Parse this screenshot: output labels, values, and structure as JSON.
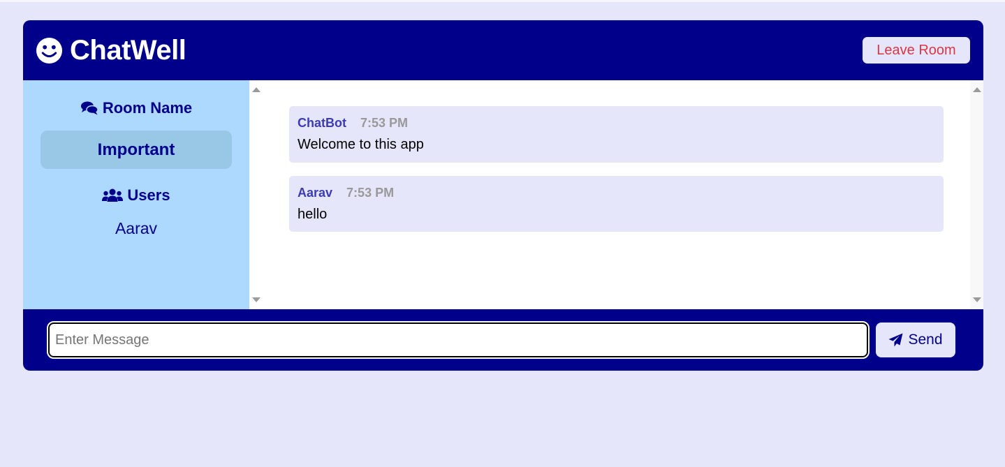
{
  "header": {
    "title": "ChatWell",
    "leave_label": "Leave Room",
    "brand_icon": "smile-icon"
  },
  "sidebar": {
    "room_heading": "Room Name",
    "room_name": "Important",
    "users_heading": "Users",
    "users": [
      "Aarav"
    ]
  },
  "messages": [
    {
      "author": "ChatBot",
      "time": "7:53 PM",
      "text": "Welcome to this app"
    },
    {
      "author": "Aarav",
      "time": "7:53 PM",
      "text": "hello"
    }
  ],
  "form": {
    "placeholder": "Enter Message",
    "send_label": "Send"
  },
  "colors": {
    "background": "#e6e6fa",
    "primary": "#00008b",
    "sidebar": "#add8ff",
    "danger": "#dc3545"
  }
}
